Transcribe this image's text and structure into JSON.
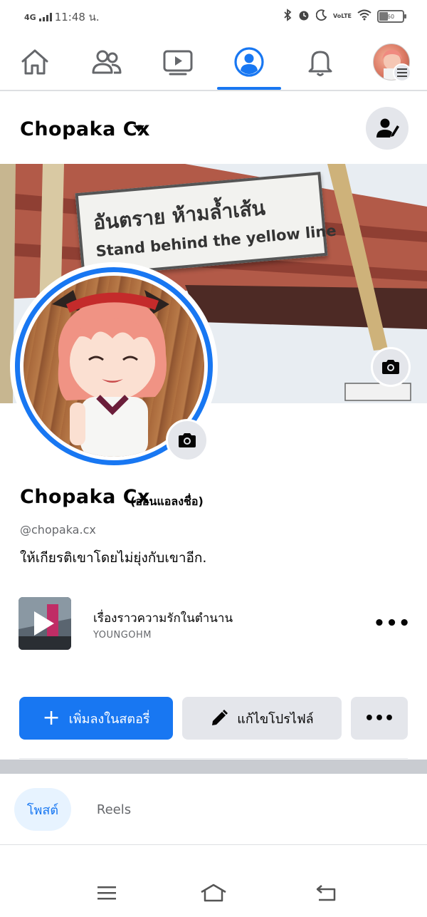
{
  "status_bar": {
    "network": "4G",
    "time": "11:48 น.",
    "volte": "VoLTE",
    "battery_level": "60"
  },
  "top_nav": {
    "tabs": [
      {
        "name": "home-icon"
      },
      {
        "name": "friends-icon"
      },
      {
        "name": "watch-icon"
      },
      {
        "name": "profile-icon",
        "active": true
      },
      {
        "name": "notifications-icon"
      },
      {
        "name": "menu-avatar"
      }
    ],
    "accent": "#1877f2"
  },
  "header": {
    "name": "Chopaka Cx"
  },
  "cover": {
    "sign_thai": "อันตราย ห้ามล้ำเส้น",
    "sign_english": "Stand behind the yellow line"
  },
  "profile": {
    "name": "Chopaka Cx",
    "alternate_name": "(อ่อนแอลงชื่อ)",
    "username": "@chopaka.cx",
    "bio": "ให้เกียรติเขาโดยไม่ยุ่งกับเขาอีก."
  },
  "music": {
    "title": "เรื่องราวความรักในตำนาน",
    "artist": "YOUNGOHM",
    "more": "•••"
  },
  "actions": {
    "add_story": "เพิ่มลงในสตอรี่",
    "edit_profile": "แก้ไขโปรไฟล์",
    "more": "•••"
  },
  "content_tabs": {
    "posts": "โพสต์",
    "reels": "Reels"
  },
  "system_nav": {
    "buttons": [
      "menu-icon",
      "home-icon",
      "back-icon"
    ]
  }
}
